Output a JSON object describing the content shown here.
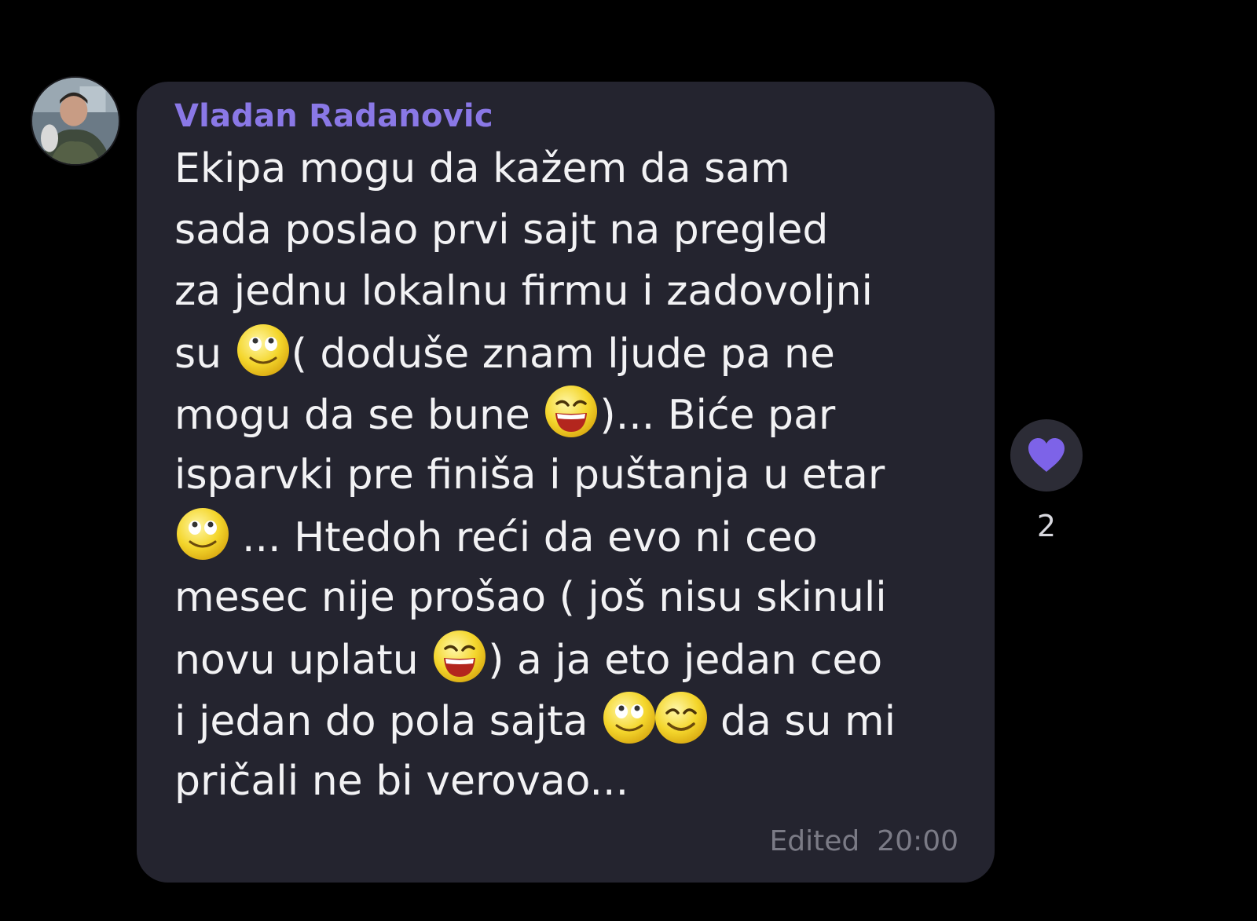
{
  "message": {
    "sender": "Vladan Radanovic",
    "lines": [
      [
        "Ekipa mogu da kažem da sam"
      ],
      [
        "sada poslao prvi sajt na pregled"
      ],
      [
        "za jednu lokalnu firmu i zadovoljni"
      ],
      [
        "su ",
        "( doduše znam ljude pa ne"
      ],
      [
        "mogu da se bune ",
        ")... Biće par"
      ],
      [
        "isparvki pre finiša i puštanja u etar"
      ],
      [
        "",
        "... Htedoh reći da evo ni ceo"
      ],
      [
        "mesec nije prošao ( još nisu skinuli"
      ],
      [
        "novu uplatu ",
        ") a ja eto jedan ceo"
      ],
      [
        "i jedan do pola sajta ",
        "da su mi"
      ],
      [
        "pričali ne bi verovao..."
      ]
    ],
    "emojis": {
      "line4": "rolling-eyes-smile-emoji",
      "line5": "laughing-emoji",
      "line7": "rolling-eyes-smile-emoji",
      "line9": "laughing-emoji",
      "line10a": "rolling-eyes-smile-emoji",
      "line10b": "smiling-closed-eyes-emoji"
    },
    "edited_label": "Edited",
    "time": "20:00"
  },
  "reaction": {
    "icon": "heart-icon",
    "count": "2",
    "color": "#7d63e8"
  },
  "colors": {
    "background": "#000000",
    "bubble": "#24242f",
    "sender": "#8a78e6",
    "text": "#f2f2f4",
    "meta": "#7b7b86"
  }
}
